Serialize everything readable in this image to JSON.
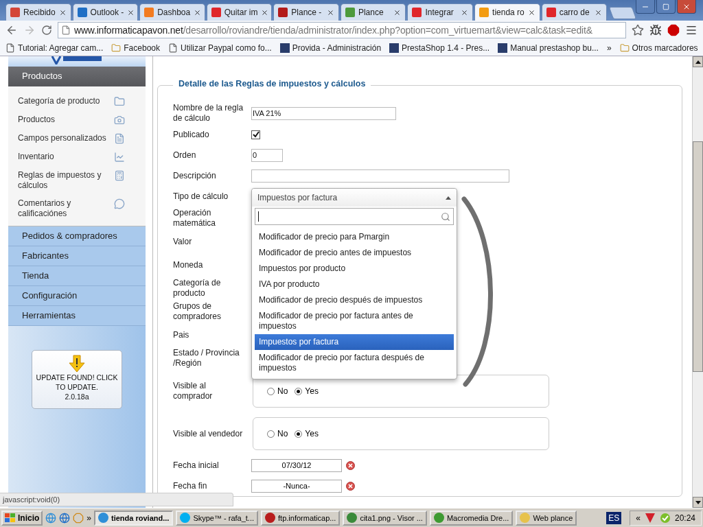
{
  "browser": {
    "tabs": [
      {
        "title": "Recibido",
        "color": "#d44638",
        "selected": false
      },
      {
        "title": "Outlook -",
        "color": "#1f6fc5",
        "selected": false
      },
      {
        "title": "Dashboa",
        "color": "#f27b21",
        "selected": false
      },
      {
        "title": "Quitar im",
        "color": "#e0262b",
        "selected": false
      },
      {
        "title": "Plance -",
        "color": "#b31b1b",
        "selected": false
      },
      {
        "title": "Plance",
        "color": "#4e9a3c",
        "selected": false
      },
      {
        "title": "Integrar",
        "color": "#e0262b",
        "selected": false
      },
      {
        "title": "tienda ro",
        "color": "#f39c12",
        "selected": true
      },
      {
        "title": "carro de",
        "color": "#e0262b",
        "selected": false
      }
    ],
    "url": {
      "host": "www.informaticapavon.net",
      "path": "/desarrollo/roviandre/tienda/administrator/index.php?option=com_virtuemart&view=calc&task=edit&"
    },
    "bookmarks": [
      {
        "label": "Tutorial: Agregar cam...",
        "kind": "page"
      },
      {
        "label": "Facebook",
        "kind": "folder"
      },
      {
        "label": "Utilizar Paypal como fo...",
        "kind": "page"
      },
      {
        "label": "Provida - Administración",
        "kind": "site"
      },
      {
        "label": "PrestaShop 1.4 - Pres...",
        "kind": "site"
      },
      {
        "label": "Manual prestashop bu...",
        "kind": "site"
      }
    ],
    "more": "»",
    "other_bookmarks": "Otros marcadores"
  },
  "sidebar": {
    "active_section": "Productos",
    "items": [
      {
        "label": "Categoría de producto",
        "kind": "folder"
      },
      {
        "label": "Productos",
        "kind": "camera"
      },
      {
        "label": "Campos personalizados",
        "kind": "fields"
      },
      {
        "label": "Inventario",
        "kind": "chart"
      },
      {
        "label": "Reglas de impuestos y cálculos",
        "kind": "calculator"
      },
      {
        "label": "Comentarios y calificaciónes",
        "kind": "comment"
      }
    ],
    "sections": [
      "Pedidos & compradores",
      "Fabricantes",
      "Tienda",
      "Configuración",
      "Herramientas"
    ],
    "update": {
      "message": "UPDATE FOUND! CLICK TO UPDATE.",
      "version": "2.0.18a"
    }
  },
  "form": {
    "legend": "Detalle de las Reglas de impuestos y cálculos",
    "rows": [
      {
        "label": "Nombre de la regla de cálculo",
        "kind": "text",
        "value": "IVA 21%"
      },
      {
        "label": "Publicado",
        "kind": "checkbox",
        "checked": true
      },
      {
        "label": "Orden",
        "kind": "text",
        "value": "0"
      },
      {
        "label": "Descripción",
        "kind": "text"
      },
      {
        "label": "Tipo de cálculo",
        "kind": "select"
      },
      {
        "label": "Operación matemática",
        "kind": "label"
      },
      {
        "label": "Valor",
        "kind": "label"
      },
      {
        "label": "Moneda",
        "kind": "label"
      },
      {
        "label": "Categoría de producto",
        "kind": "label"
      },
      {
        "label": "Grupos de compradores",
        "kind": "label"
      },
      {
        "label": "Pais",
        "kind": "label"
      },
      {
        "label": "Estado / Provincia /Región",
        "kind": "label"
      },
      {
        "label": "Visible al comprador",
        "kind": "radio",
        "options": [
          {
            "label": "No",
            "selected": false
          },
          {
            "label": "Yes",
            "selected": true
          }
        ]
      },
      {
        "label": "Visible al vendedor",
        "kind": "radio",
        "options": [
          {
            "label": "No",
            "selected": false
          },
          {
            "label": "Yes",
            "selected": true
          }
        ]
      },
      {
        "label": "Fecha inicial",
        "kind": "date",
        "value": "07/30/12"
      },
      {
        "label": "Fecha fin",
        "kind": "date",
        "value": "-Nunca-"
      }
    ]
  },
  "dropdown": {
    "value": "Impuestos por factura",
    "options": [
      {
        "label": "Modificador de precio para Pmargin",
        "selected": false
      },
      {
        "label": "Modificador de precio antes de impuestos",
        "selected": false
      },
      {
        "label": "Impuestos por producto",
        "selected": false
      },
      {
        "label": "IVA por producto",
        "selected": false
      },
      {
        "label": "Modificador de precio después de impuestos",
        "selected": false
      },
      {
        "label": "Modificador de precio por factura antes de impuestos",
        "selected": false
      },
      {
        "label": "Impuestos por factura",
        "selected": true
      },
      {
        "label": "Modificador de precio por factura después de impuestos",
        "selected": false
      }
    ]
  },
  "status_text": "javascript:void(0)",
  "taskbar": {
    "start": "Inicio",
    "more": "»",
    "tasks": [
      {
        "label": "tienda roviand...",
        "selected": true
      },
      {
        "label": "Skype™ - rafa_t...",
        "selected": false
      },
      {
        "label": "ftp.informaticap...",
        "selected": false
      },
      {
        "label": "cita1.png - Visor ...",
        "selected": false
      },
      {
        "label": "Macromedia Dre...",
        "selected": false
      },
      {
        "label": "Web plance",
        "selected": false
      }
    ],
    "language": "ES",
    "tray_more": "«",
    "clock": "20:24"
  }
}
